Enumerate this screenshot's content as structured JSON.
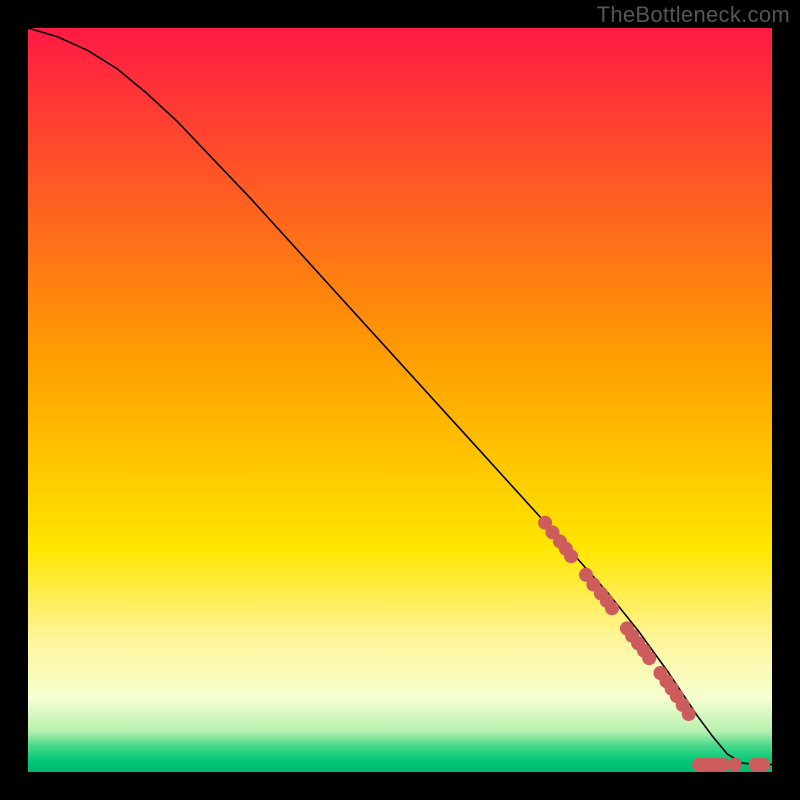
{
  "watermark": "TheBottleneck.com",
  "chart_data": {
    "type": "line",
    "title": "",
    "xlabel": "",
    "ylabel": "",
    "xlim": [
      0,
      100
    ],
    "ylim": [
      0,
      100
    ],
    "grid": false,
    "background_gradient": {
      "stops": [
        {
          "offset": 0.0,
          "color": "#ff1a44"
        },
        {
          "offset": 0.45,
          "color": "#ffa000"
        },
        {
          "offset": 0.7,
          "color": "#ffe600"
        },
        {
          "offset": 0.82,
          "color": "#fff59a"
        },
        {
          "offset": 0.9,
          "color": "#f6ffd0"
        },
        {
          "offset": 0.945,
          "color": "#b8f0b0"
        },
        {
          "offset": 0.965,
          "color": "#48d88a"
        },
        {
          "offset": 0.985,
          "color": "#00c878"
        },
        {
          "offset": 1.0,
          "color": "#00b870"
        }
      ]
    },
    "series": [
      {
        "name": "curve",
        "x": [
          0,
          4,
          8,
          12,
          16,
          20,
          30,
          40,
          50,
          60,
          70,
          78,
          82,
          86,
          88,
          90,
          92,
          94,
          96,
          98,
          100
        ],
        "y": [
          100,
          98.8,
          97.0,
          94.5,
          91.2,
          87.5,
          77.0,
          66.0,
          55.0,
          44.0,
          33.0,
          24.0,
          19.0,
          13.5,
          10.5,
          7.5,
          4.8,
          2.4,
          1.2,
          1.0,
          1.0
        ]
      }
    ],
    "markers": [
      {
        "x": 69.5,
        "y": 33.5
      },
      {
        "x": 70.5,
        "y": 32.2
      },
      {
        "x": 71.5,
        "y": 31.0
      },
      {
        "x": 72.3,
        "y": 30.0
      },
      {
        "x": 73.0,
        "y": 29.0
      },
      {
        "x": 75.0,
        "y": 26.5
      },
      {
        "x": 76.0,
        "y": 25.2
      },
      {
        "x": 77.0,
        "y": 24.0
      },
      {
        "x": 77.8,
        "y": 23.0
      },
      {
        "x": 78.5,
        "y": 22.0
      },
      {
        "x": 80.5,
        "y": 19.3
      },
      {
        "x": 81.2,
        "y": 18.3
      },
      {
        "x": 82.0,
        "y": 17.3
      },
      {
        "x": 82.8,
        "y": 16.3
      },
      {
        "x": 83.5,
        "y": 15.3
      },
      {
        "x": 85.0,
        "y": 13.3
      },
      {
        "x": 85.8,
        "y": 12.2
      },
      {
        "x": 86.5,
        "y": 11.2
      },
      {
        "x": 87.2,
        "y": 10.2
      },
      {
        "x": 88.0,
        "y": 9.0
      },
      {
        "x": 88.8,
        "y": 7.8
      },
      {
        "x": 90.2,
        "y": 1.0
      },
      {
        "x": 91.0,
        "y": 1.0
      },
      {
        "x": 91.8,
        "y": 1.0
      },
      {
        "x": 92.6,
        "y": 1.0
      },
      {
        "x": 93.4,
        "y": 1.0
      },
      {
        "x": 95.0,
        "y": 1.0
      },
      {
        "x": 97.8,
        "y": 1.0
      },
      {
        "x": 98.8,
        "y": 1.0
      }
    ],
    "marker_style": {
      "color": "#cd5c5c",
      "radius_px": 7
    }
  }
}
